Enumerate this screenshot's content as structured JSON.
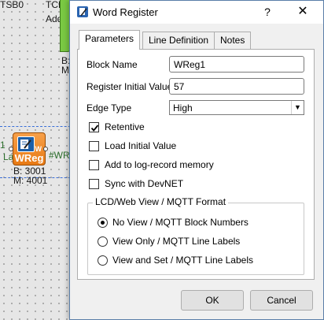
{
  "background": {
    "top_labels": [
      "TSB0",
      "TCP"
    ],
    "top_sublabels": [
      "Add"
    ],
    "mid_left_labels": [
      "B:",
      "M:"
    ],
    "left_wire_labels": [
      "1",
      "Lat"
    ],
    "block": {
      "name": "WReg",
      "bus_address": "B: 3001",
      "memory_address": "M: 4001"
    },
    "output_label": "#WR"
  },
  "dialog": {
    "title": "Word Register",
    "help_glyph": "?",
    "close_glyph": "✕",
    "tabs": [
      {
        "label": "Parameters",
        "active": true
      },
      {
        "label": "Line Definition",
        "active": false
      },
      {
        "label": "Notes",
        "active": false
      }
    ],
    "fields": {
      "block_name": {
        "label": "Block Name",
        "value": "WReg1"
      },
      "register_initial_value": {
        "label": "Register Initial Value",
        "value": "57"
      },
      "edge_type": {
        "label": "Edge Type",
        "value": "High"
      }
    },
    "checkboxes": [
      {
        "label": "Retentive",
        "checked": true
      },
      {
        "label": "Load Initial Value",
        "checked": false
      },
      {
        "label": "Add to log-record memory",
        "checked": false
      },
      {
        "label": "Sync with DevNET",
        "checked": false
      }
    ],
    "format_group": {
      "title": "LCD/Web View / MQTT Format",
      "options": [
        {
          "label": "No View / MQTT Block Numbers",
          "selected": true
        },
        {
          "label": "View Only / MQTT Line Labels",
          "selected": false
        },
        {
          "label": "View and Set / MQTT Line Labels",
          "selected": false
        }
      ]
    },
    "buttons": {
      "ok": "OK",
      "cancel": "Cancel"
    }
  },
  "colors": {
    "block_orange": "#e87a14",
    "block_green": "#7ac943",
    "selection_blue": "#3a6fd8"
  }
}
